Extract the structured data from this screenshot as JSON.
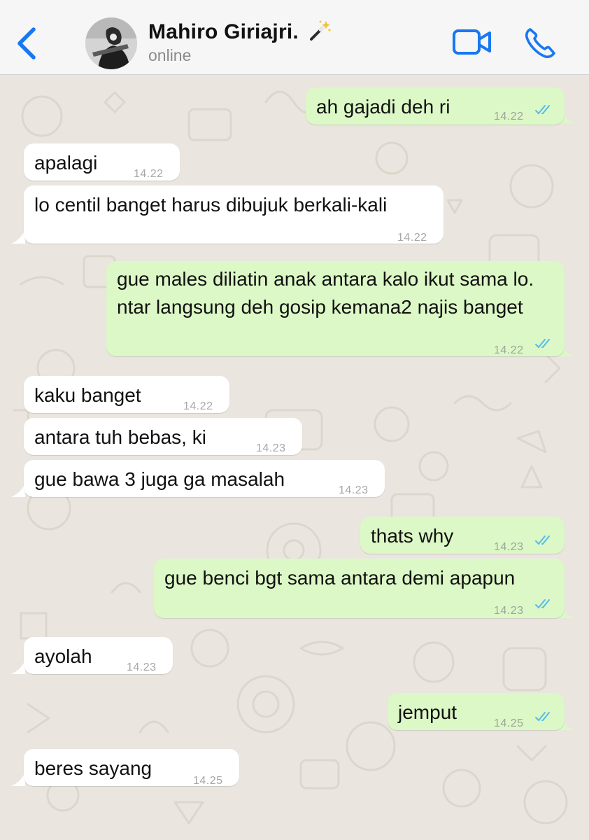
{
  "header": {
    "contact_name": "Mahiro Giriajri.",
    "status": "online"
  },
  "colors": {
    "accent": "#1877f2",
    "incoming_bubble": "#ffffff",
    "outgoing_bubble": "#dcf8c6",
    "read_tick": "#53bdeb",
    "background": "#eae6df"
  },
  "icons": [
    "back-chevron-icon",
    "magic-wand-icon",
    "video-call-icon",
    "phone-icon",
    "double-check-icon"
  ],
  "messages": [
    {
      "dir": "out",
      "text": "ah gajadi deh ri",
      "time": "14.22",
      "read": true
    },
    {
      "dir": "in",
      "text": "apalagi",
      "time": "14.22"
    },
    {
      "dir": "in",
      "text": "lo centil banget harus dibujuk berkali-kali",
      "time": "14.22"
    },
    {
      "dir": "out",
      "text": "gue males diliatin anak antara kalo ikut sama lo. ntar langsung deh gosip kemana2 najis banget",
      "time": "14.22",
      "read": true
    },
    {
      "dir": "in",
      "text": "kaku banget",
      "time": "14.22"
    },
    {
      "dir": "in",
      "text": "antara tuh bebas, ki",
      "time": "14.23"
    },
    {
      "dir": "in",
      "text": "gue bawa 3 juga ga masalah",
      "time": "14.23"
    },
    {
      "dir": "out",
      "text": "thats why",
      "time": "14.23",
      "read": true
    },
    {
      "dir": "out",
      "text": "gue benci bgt sama antara demi apapun",
      "time": "14.23",
      "read": true
    },
    {
      "dir": "in",
      "text": "ayolah",
      "time": "14.23"
    },
    {
      "dir": "out",
      "text": "jemput",
      "time": "14.25",
      "read": true
    },
    {
      "dir": "in",
      "text": "beres sayang",
      "time": "14.25"
    }
  ]
}
